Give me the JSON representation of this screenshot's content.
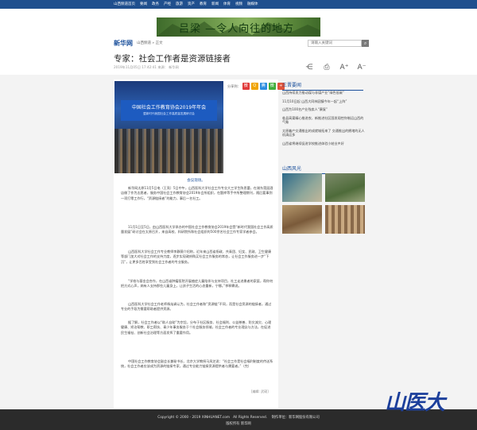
{
  "topnav": {
    "items": [
      "山西频道首页",
      "要闻",
      "政务",
      "产经",
      "旅游",
      "资产",
      "教育",
      "新闻",
      "体育",
      "视频",
      "融媒体"
    ]
  },
  "banner": {
    "title": "吕梁 —令人向往的地方"
  },
  "header": {
    "logo": "新华网",
    "breadcrumb": "山西频道 » 正文",
    "search_placeholder": "请输入关键词"
  },
  "article": {
    "title": "专家：社会工作者是资源链接者",
    "meta": "2019年11月05日 17:42:41    来源：    新华网",
    "photo_title": "中国社会工作教育协会2019年年会",
    "photo_sub": "暨新时代我国社会工作高质量发展研讨会",
    "share_label": "分享到：",
    "caption": "会议现场。",
    "paragraphs": [
      "新华网太原11月5日电（王亮）5日中午，山西医科大学社会工作专业大三学生陈思蕾，在湖东莲园酒店做了作为志愿者，服务中国社会工作教育协会2019年会所组织，在题库等手中所整理期刊，随后要事到一项打零工作行，“资源链接者”的能力，事后一名社工。",
      "11月1日至5日，由山西医科大学承办的中国社会工作教育协会2019年会暨“新时代我国社会工作高质量发展”研讨会在太原召开，来自高校、科研院所和社会组织的500余名社会工作专家学者参会。",
      "山西医科大学社会工作专业教师李静薇介绍称，近年来山西省扬政、共青团、妇女、民政、卫生健康等部门加大对社会工作的支持力度，逐步实现政府购买社会工作服务的常态，让社会工作服务进一步“下沉”，让更多百姓享受到社会工作者的专业服务。",
      "“学校与基金会合作，在山西省肿瘤医院开展癌症儿童陪伴与支持项目，社工走进患者的家庭，帮你何把方式心声，病有人支持那些儿童身上，让孩子生活的心态重新，宁娜。”李释霖说。",
      "山西医科大学社会工作老师杨灿调认为，社会工作者和“资源链”不同，而是社会资源的链接者，通过专业的手段为需要帮助者提供资源。",
      "据了解，社会工作者以“助人自助”为宗旨，分布于社区服务、社会福利、公益慈善、防灾减灾、心理健康、矫治帮教、职工帮扶、青少年事务服务于个社会服务领域，社会工作者的专业理念与方法，在促进民生福祉、创新社会治理等方面发挥了重要作用。",
      "中国社会工作教育协会副会长兼秘书长、北京大学教授马凤芝说：“社会工作是社会福利制度的传送系统，社会工作者应该成为资源的链接专家，通过专业能力链接资源提供者与需要者。”（完）"
    ],
    "editor": "[编辑: 武硕]"
  },
  "tools": [
    "share-icon",
    "print-icon",
    "font-larger-icon",
    "font-smaller-icon"
  ],
  "sidebar": {
    "news_title": "三晋要闻",
    "news": [
      "山西持续发力推动煤与非煤产业“绿色低碳”",
      "11月10日起 山西大同林园镇今年—起“上阵”",
      "山西为100名产业残疾人“康复”",
      "临县高渠精心推进农、新推进社区国发观控你制运山西的气象",
      "太原着产交通推出的成就城拓来了 交通推出的拥堵的无人机清运多",
      "山西省将继续促进学校推进体验小结业乡好"
    ],
    "scenery_title": "山西风光"
  },
  "footer": {
    "line1": "Copyright © 2000 - 2019 XINHUANET.com   All Rights Reserved.    制作单位：新华网股份有限公司",
    "line2": "版权所有 新华网"
  },
  "watermark": "山医大",
  "colors": {
    "nav": "#1f4f8e",
    "link": "#1a4f9b",
    "footer": "#2b2b2b"
  }
}
